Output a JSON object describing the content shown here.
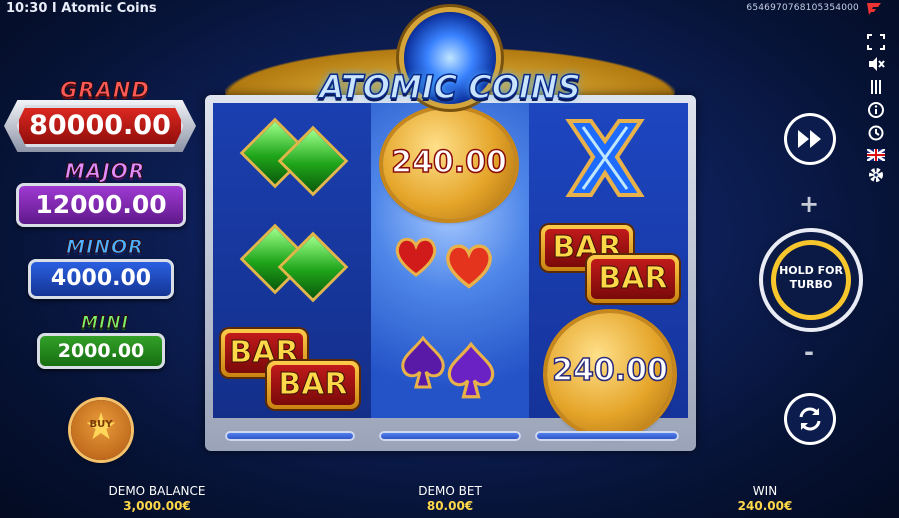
{
  "topbar": {
    "clock_title": "10:30 I Atomic Coins",
    "session_id": "6546970768105354000"
  },
  "logo": {
    "text": "ATOMIC COINS"
  },
  "jackpots": [
    {
      "label": "GRAND",
      "value": "80000.00"
    },
    {
      "label": "MAJOR",
      "value": "12000.00"
    },
    {
      "label": "MINOR",
      "value": "4000.00"
    },
    {
      "label": "MINI",
      "value": "2000.00"
    }
  ],
  "buy": {
    "label": "BUY"
  },
  "reels": {
    "coin_values": [
      "240.00",
      "240.00"
    ],
    "bar_label": "BAR"
  },
  "controls": {
    "turbo_line1": "HOLD FOR",
    "turbo_line2": "TURBO",
    "plus": "+",
    "minus": "-"
  },
  "bottom": {
    "balance_label": "DEMO BALANCE",
    "balance_value": "3,000.00€",
    "bet_label": "DEMO BET",
    "bet_value": "80.00€",
    "win_label": "WIN",
    "win_value": "240.00€"
  },
  "colors": {
    "gold": "#f6c62c",
    "grand": "#e12a22",
    "major": "#a43dd8",
    "minor": "#2d63e8",
    "mini": "#35a52a"
  }
}
